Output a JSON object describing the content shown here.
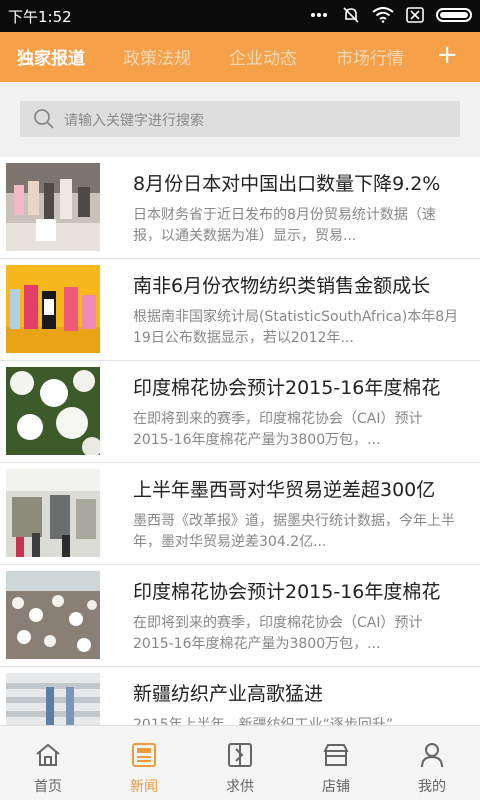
{
  "status_bar": {
    "time": "下午1:52"
  },
  "tabs": [
    {
      "label": "独家报道",
      "active": true
    },
    {
      "label": "政策法规",
      "active": false
    },
    {
      "label": "企业动态",
      "active": false
    },
    {
      "label": "市场行情",
      "active": false
    }
  ],
  "add_tab_symbol": "+",
  "search": {
    "placeholder": "请输入关键字进行搜索"
  },
  "colors": {
    "accent": "#f6a04a",
    "active_nav": "#f09a3e"
  },
  "news": [
    {
      "title": "8月份日本对中国出口数量下降9.2%",
      "desc": "日本财务省于近日发布的8月份贸易统计数据（速报，以通关数据为准）显示，贸易..."
    },
    {
      "title": "南非6月份衣物纺织类销售金额成长",
      "desc": "根据南非国家统计局(StatisticSouthAfrica)本年8月19日公布数据显示，若以2012年..."
    },
    {
      "title": "印度棉花协会预计2015-16年度棉花",
      "desc": "在即将到来的赛季，印度棉花协会（CAI）预计2015-16年度棉花产量为3800万包，..."
    },
    {
      "title": "上半年墨西哥对华贸易逆差超300亿",
      "desc": "墨西哥《改革报》道，据墨央行统计数据，今年上半年，墨对华贸易逆差304.2亿..."
    },
    {
      "title": "印度棉花协会预计2015-16年度棉花",
      "desc": "在即将到来的赛季，印度棉花协会（CAI）预计2015-16年度棉花产量为3800万包，..."
    },
    {
      "title": "新疆纺织产业高歌猛进",
      "desc": "2015年上半年，新疆纺织工业“逐步回升”"
    }
  ],
  "bottom_nav": [
    {
      "label": "首页",
      "icon": "home-icon",
      "active": false
    },
    {
      "label": "新闻",
      "icon": "newspaper-icon",
      "active": true
    },
    {
      "label": "求供",
      "icon": "exchange-icon",
      "active": false
    },
    {
      "label": "店铺",
      "icon": "store-icon",
      "active": false
    },
    {
      "label": "我的",
      "icon": "user-icon",
      "active": false
    }
  ]
}
